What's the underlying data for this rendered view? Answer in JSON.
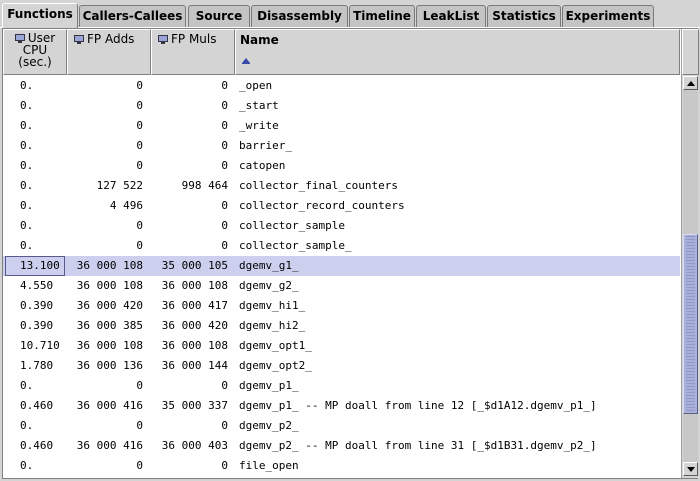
{
  "tabs": [
    {
      "label": "Functions",
      "active": true
    },
    {
      "label": "Callers-Callees",
      "active": false
    },
    {
      "label": "Source",
      "active": false
    },
    {
      "label": "Disassembly",
      "active": false
    },
    {
      "label": "Timeline",
      "active": false
    },
    {
      "label": "LeakList",
      "active": false
    },
    {
      "label": "Statistics",
      "active": false
    },
    {
      "label": "Experiments",
      "active": false
    }
  ],
  "columns": {
    "user_cpu": {
      "line1": "User",
      "line2": "CPU",
      "line3": "(sec.)"
    },
    "fp_adds": {
      "label": "FP  Adds"
    },
    "fp_muls": {
      "label": "FP  Muls"
    },
    "name": {
      "label": "Name"
    }
  },
  "selected_row_index": 9,
  "colors": {
    "selection": "#cccfee",
    "scroll_thumb": "#a9b0d9",
    "panel_bg": "#d4d4d4"
  },
  "rows": [
    {
      "cpu": "0.",
      "adds": "0",
      "muls": "0",
      "name": "_open"
    },
    {
      "cpu": "0.",
      "adds": "0",
      "muls": "0",
      "name": "_start"
    },
    {
      "cpu": "0.",
      "adds": "0",
      "muls": "0",
      "name": "_write"
    },
    {
      "cpu": "0.",
      "adds": "0",
      "muls": "0",
      "name": "barrier_"
    },
    {
      "cpu": "0.",
      "adds": "0",
      "muls": "0",
      "name": "catopen"
    },
    {
      "cpu": "0.",
      "adds": "127 522",
      "muls": "998 464",
      "name": "collector_final_counters"
    },
    {
      "cpu": "0.",
      "adds": "4 496",
      "muls": "0",
      "name": "collector_record_counters"
    },
    {
      "cpu": "0.",
      "adds": "0",
      "muls": "0",
      "name": "collector_sample"
    },
    {
      "cpu": "0.",
      "adds": "0",
      "muls": "0",
      "name": "collector_sample_"
    },
    {
      "cpu": "13.100",
      "adds": "36 000 108",
      "muls": "35 000 105",
      "name": "dgemv_g1_"
    },
    {
      "cpu": "4.550",
      "adds": "36 000 108",
      "muls": "36 000 108",
      "name": "dgemv_g2_"
    },
    {
      "cpu": "0.390",
      "adds": "36 000 420",
      "muls": "36 000 417",
      "name": "dgemv_hi1_"
    },
    {
      "cpu": "0.390",
      "adds": "36 000 385",
      "muls": "36 000 420",
      "name": "dgemv_hi2_"
    },
    {
      "cpu": "10.710",
      "adds": "36 000 108",
      "muls": "36 000 108",
      "name": "dgemv_opt1_"
    },
    {
      "cpu": "1.780",
      "adds": "36 000 136",
      "muls": "36 000 144",
      "name": "dgemv_opt2_"
    },
    {
      "cpu": "0.",
      "adds": "0",
      "muls": "0",
      "name": "dgemv_p1_"
    },
    {
      "cpu": "0.460",
      "adds": "36 000 416",
      "muls": "35 000 337",
      "name": "dgemv_p1_ -- MP doall from line 12 [_$d1A12.dgemv_p1_]"
    },
    {
      "cpu": "0.",
      "adds": "0",
      "muls": "0",
      "name": "dgemv_p2_"
    },
    {
      "cpu": "0.460",
      "adds": "36 000 416",
      "muls": "36 000 403",
      "name": "dgemv_p2_ -- MP doall from line 31 [_$d1B31.dgemv_p2_]"
    },
    {
      "cpu": "0.",
      "adds": "0",
      "muls": "0",
      "name": "file_open"
    }
  ]
}
